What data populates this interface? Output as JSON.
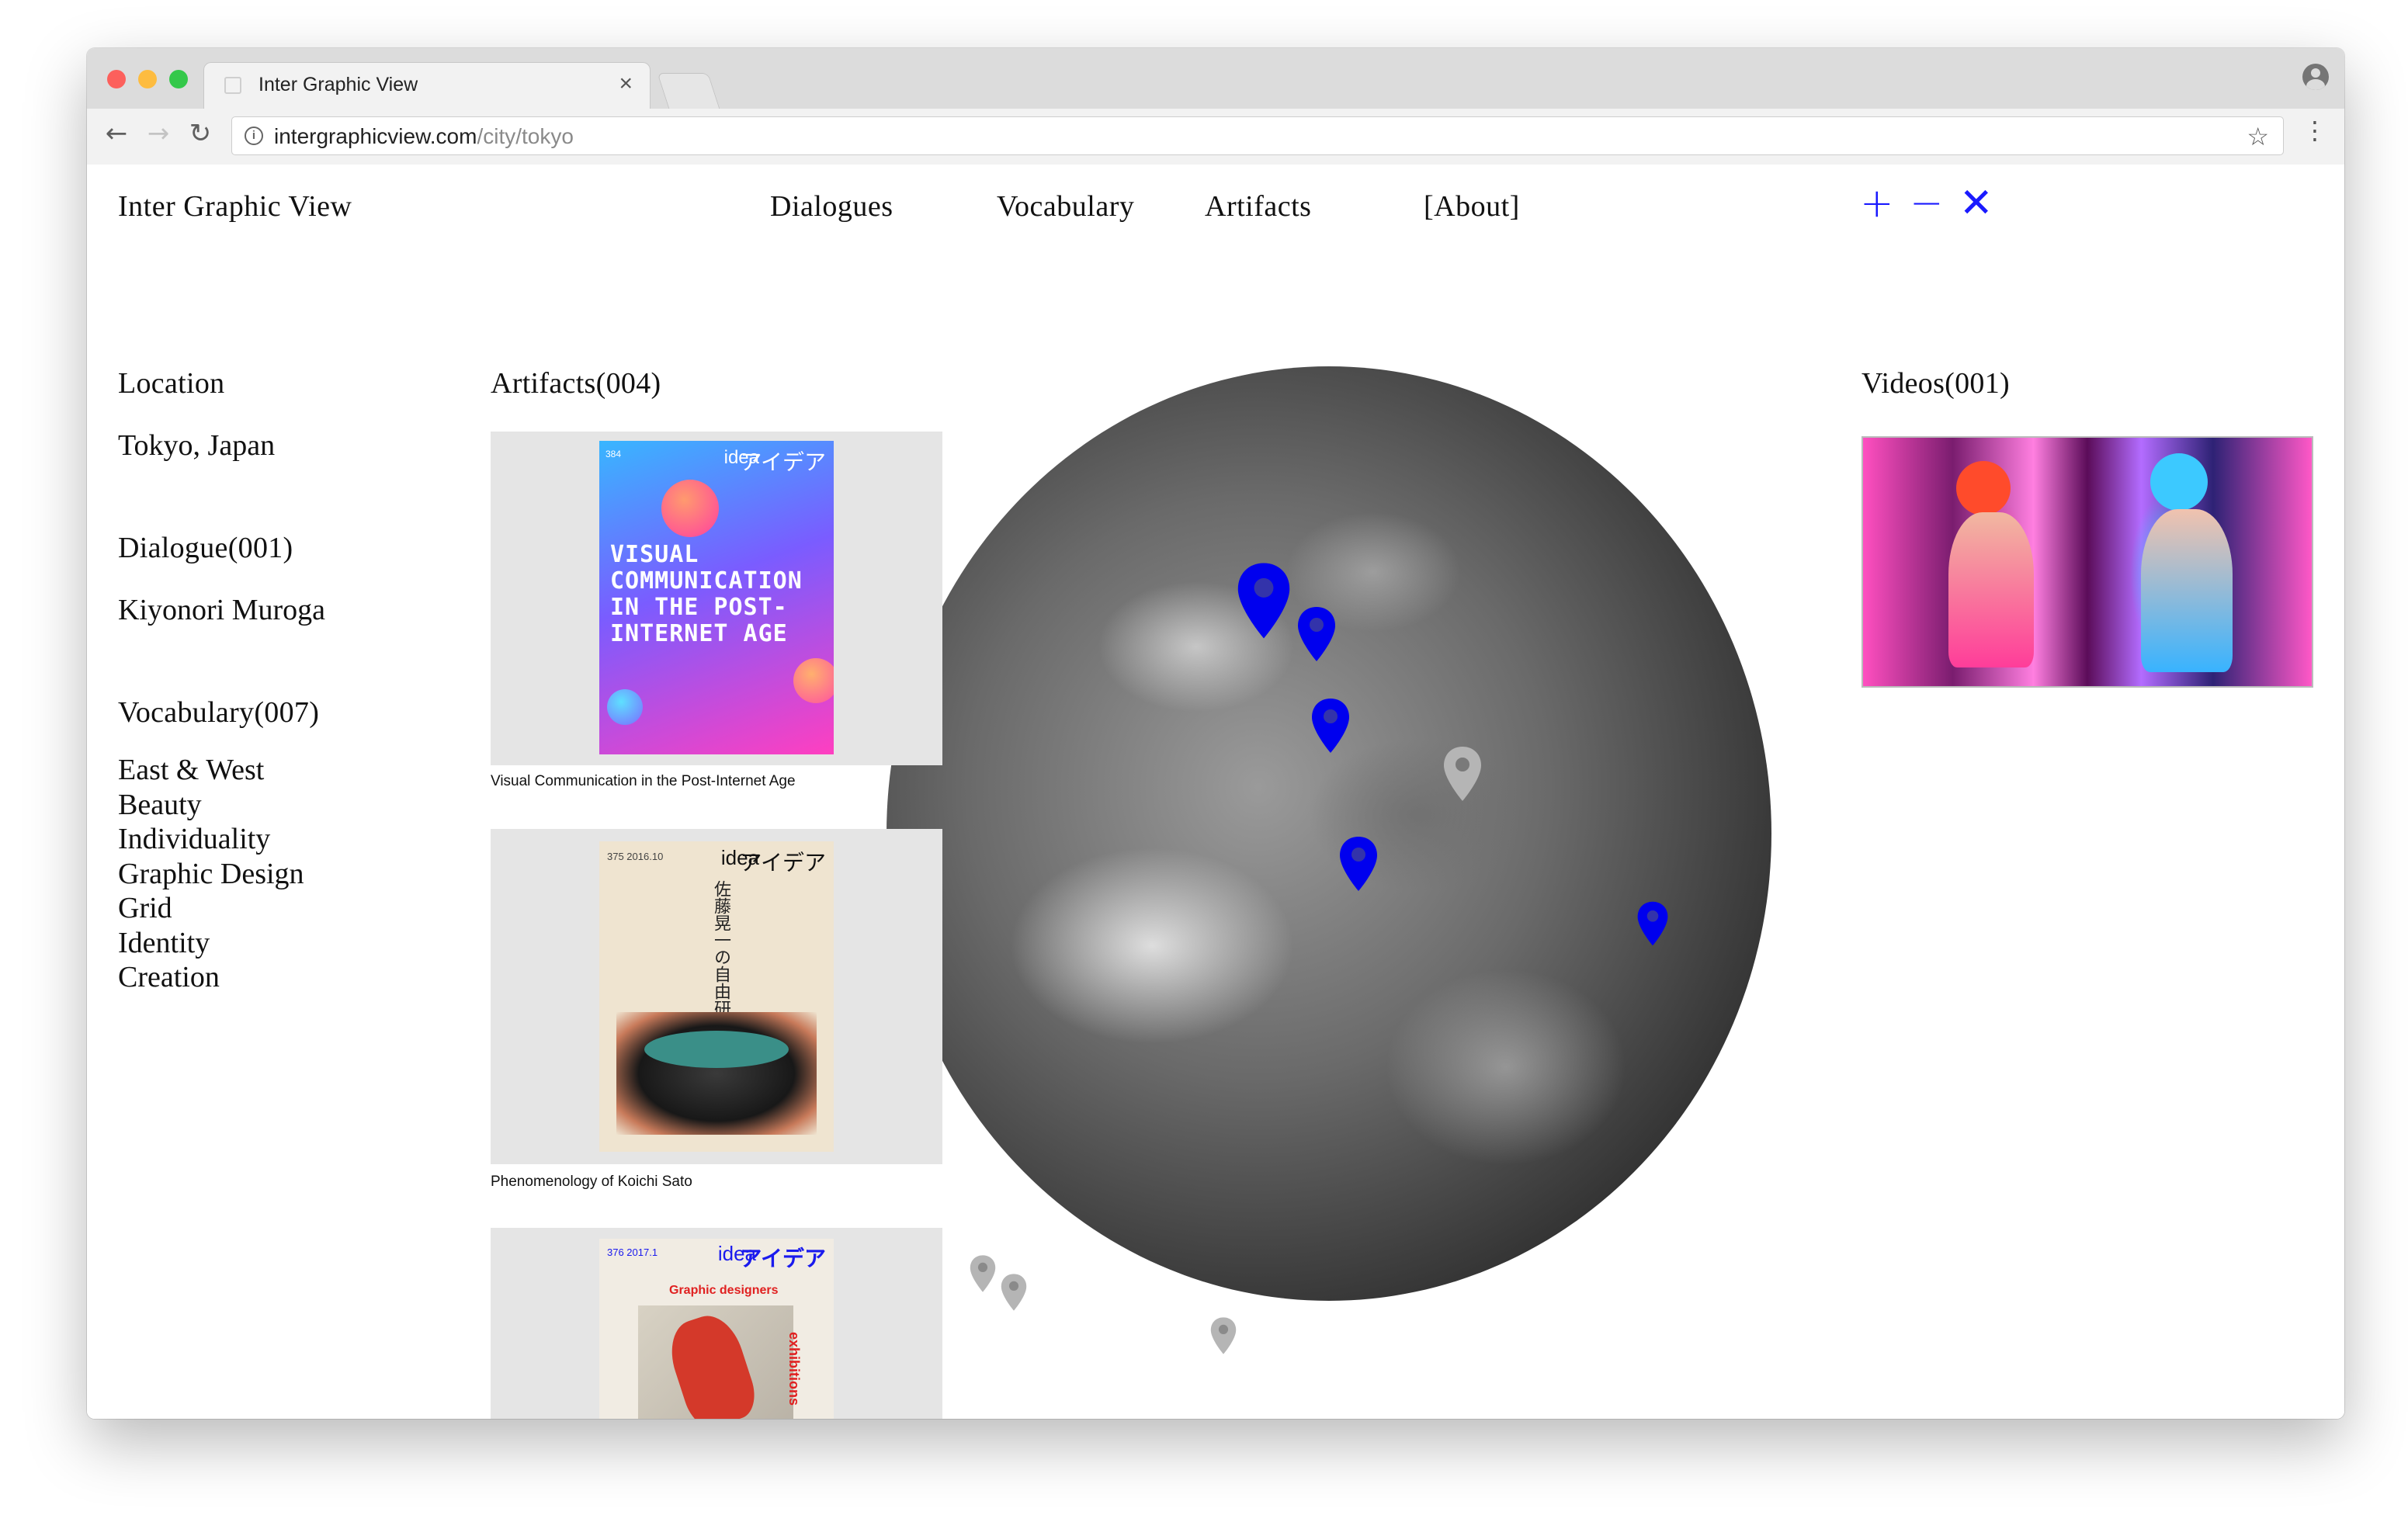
{
  "browser": {
    "tab_title": "Inter Graphic View",
    "tab_close": "×",
    "url_host": "intergraphicview.com",
    "url_path": "/city/tokyo"
  },
  "site": {
    "title": "Inter Graphic View",
    "nav": [
      "Dialogues",
      "Vocabulary",
      "Artifacts",
      "[About]"
    ],
    "controls": {
      "zoom_in": "+",
      "zoom_out": "−",
      "close": "✕"
    },
    "accent_color": "#1a1aff"
  },
  "sidebar": {
    "location_label": "Location",
    "location_value": "Tokyo, Japan",
    "dialogue_label": "Dialogue(001)",
    "dialogue_value": "Kiyonori Muroga",
    "vocabulary_label": "Vocabulary(007)",
    "vocabulary_items": [
      "East & West",
      "Beauty",
      "Individuality",
      "Graphic Design",
      "Grid",
      "Identity",
      "Creation"
    ]
  },
  "artifacts": {
    "label": "Artifacts(004)",
    "items": [
      {
        "caption": "Visual Communication in the Post-Internet Age",
        "cover_brand": "idea",
        "cover_brand_jp": "アイデア",
        "cover_text": "VISUAL COMMUNICATION IN THE POST-INTERNET AGE",
        "cover_issue": "384"
      },
      {
        "caption": "Phenomenology of Koichi Sato",
        "cover_brand": "idea",
        "cover_brand_jp": "アイデア",
        "cover_issue": "375 2016.10",
        "cover_text_jp": "佐藤晃一の自由研究"
      },
      {
        "caption": "",
        "cover_brand": "idea",
        "cover_brand_jp": "アイデア",
        "cover_issue": "376 2017.1",
        "cover_text": "Graphic designers",
        "cover_side": "exhibitions"
      }
    ]
  },
  "videos": {
    "label": "Videos(001)"
  },
  "map": {
    "active_pin_color": "#0000ee",
    "inactive_pin_color": "#b5b5b5"
  }
}
